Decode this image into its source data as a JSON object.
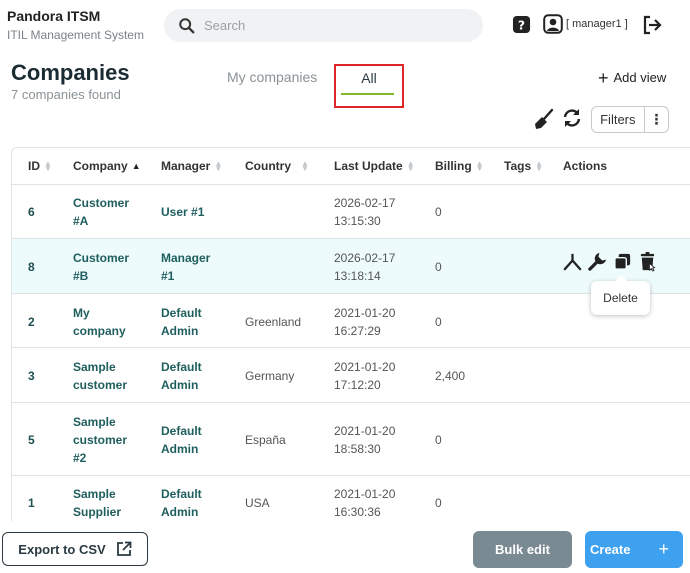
{
  "header": {
    "app_name": "Pandora ITSM",
    "app_subtitle": "ITIL Management System",
    "search_placeholder": "Search",
    "user_label": "[ manager1 ]"
  },
  "page": {
    "title": "Companies",
    "found_text": "7 companies found",
    "tabs": [
      {
        "label": "My companies"
      },
      {
        "label": "All"
      }
    ],
    "add_view_label": "Add view",
    "filters_label": "Filters"
  },
  "table": {
    "columns": [
      "ID",
      "Company",
      "Manager",
      "Country",
      "Last Update",
      "Billing",
      "Tags",
      "Actions"
    ],
    "rows": [
      {
        "id": "6",
        "company": [
          "Customer",
          "#A"
        ],
        "manager": [
          "User #1"
        ],
        "country": "",
        "date": "2026-02-17",
        "time": "13:15:30",
        "billing": "0"
      },
      {
        "id": "8",
        "company": [
          "Customer",
          "#B"
        ],
        "manager": [
          "Manager",
          "#1"
        ],
        "country": "",
        "date": "2026-02-17",
        "time": "13:18:14",
        "billing": "0"
      },
      {
        "id": "2",
        "company": [
          "My",
          "company"
        ],
        "manager": [
          "Default",
          "Admin"
        ],
        "country": "Greenland",
        "date": "2021-01-20",
        "time": "16:27:29",
        "billing": "0"
      },
      {
        "id": "3",
        "company": [
          "Sample",
          "customer"
        ],
        "manager": [
          "Default",
          "Admin"
        ],
        "country": "Germany",
        "date": "2021-01-20",
        "time": "17:12:20",
        "billing": "2,400"
      },
      {
        "id": "5",
        "company": [
          "Sample",
          "customer",
          "#2"
        ],
        "manager": [
          "Default",
          "Admin"
        ],
        "country": "España",
        "date": "2021-01-20",
        "time": "18:58:30",
        "billing": "0"
      },
      {
        "id": "1",
        "company": [
          "Sample",
          "Supplier"
        ],
        "manager": [
          "Default",
          "Admin"
        ],
        "country": "USA",
        "date": "2021-01-20",
        "time": "16:30:36",
        "billing": "0"
      }
    ],
    "tooltip": "Delete"
  },
  "footer": {
    "export_label": "Export to CSV",
    "bulk_label": "Bulk edit",
    "create_label": "Create"
  },
  "colors": {
    "accent_green": "#82b92e",
    "create_blue": "#3ea1f0",
    "bulk_gray": "#7a8a93",
    "highlight_red": "#e0262a"
  }
}
